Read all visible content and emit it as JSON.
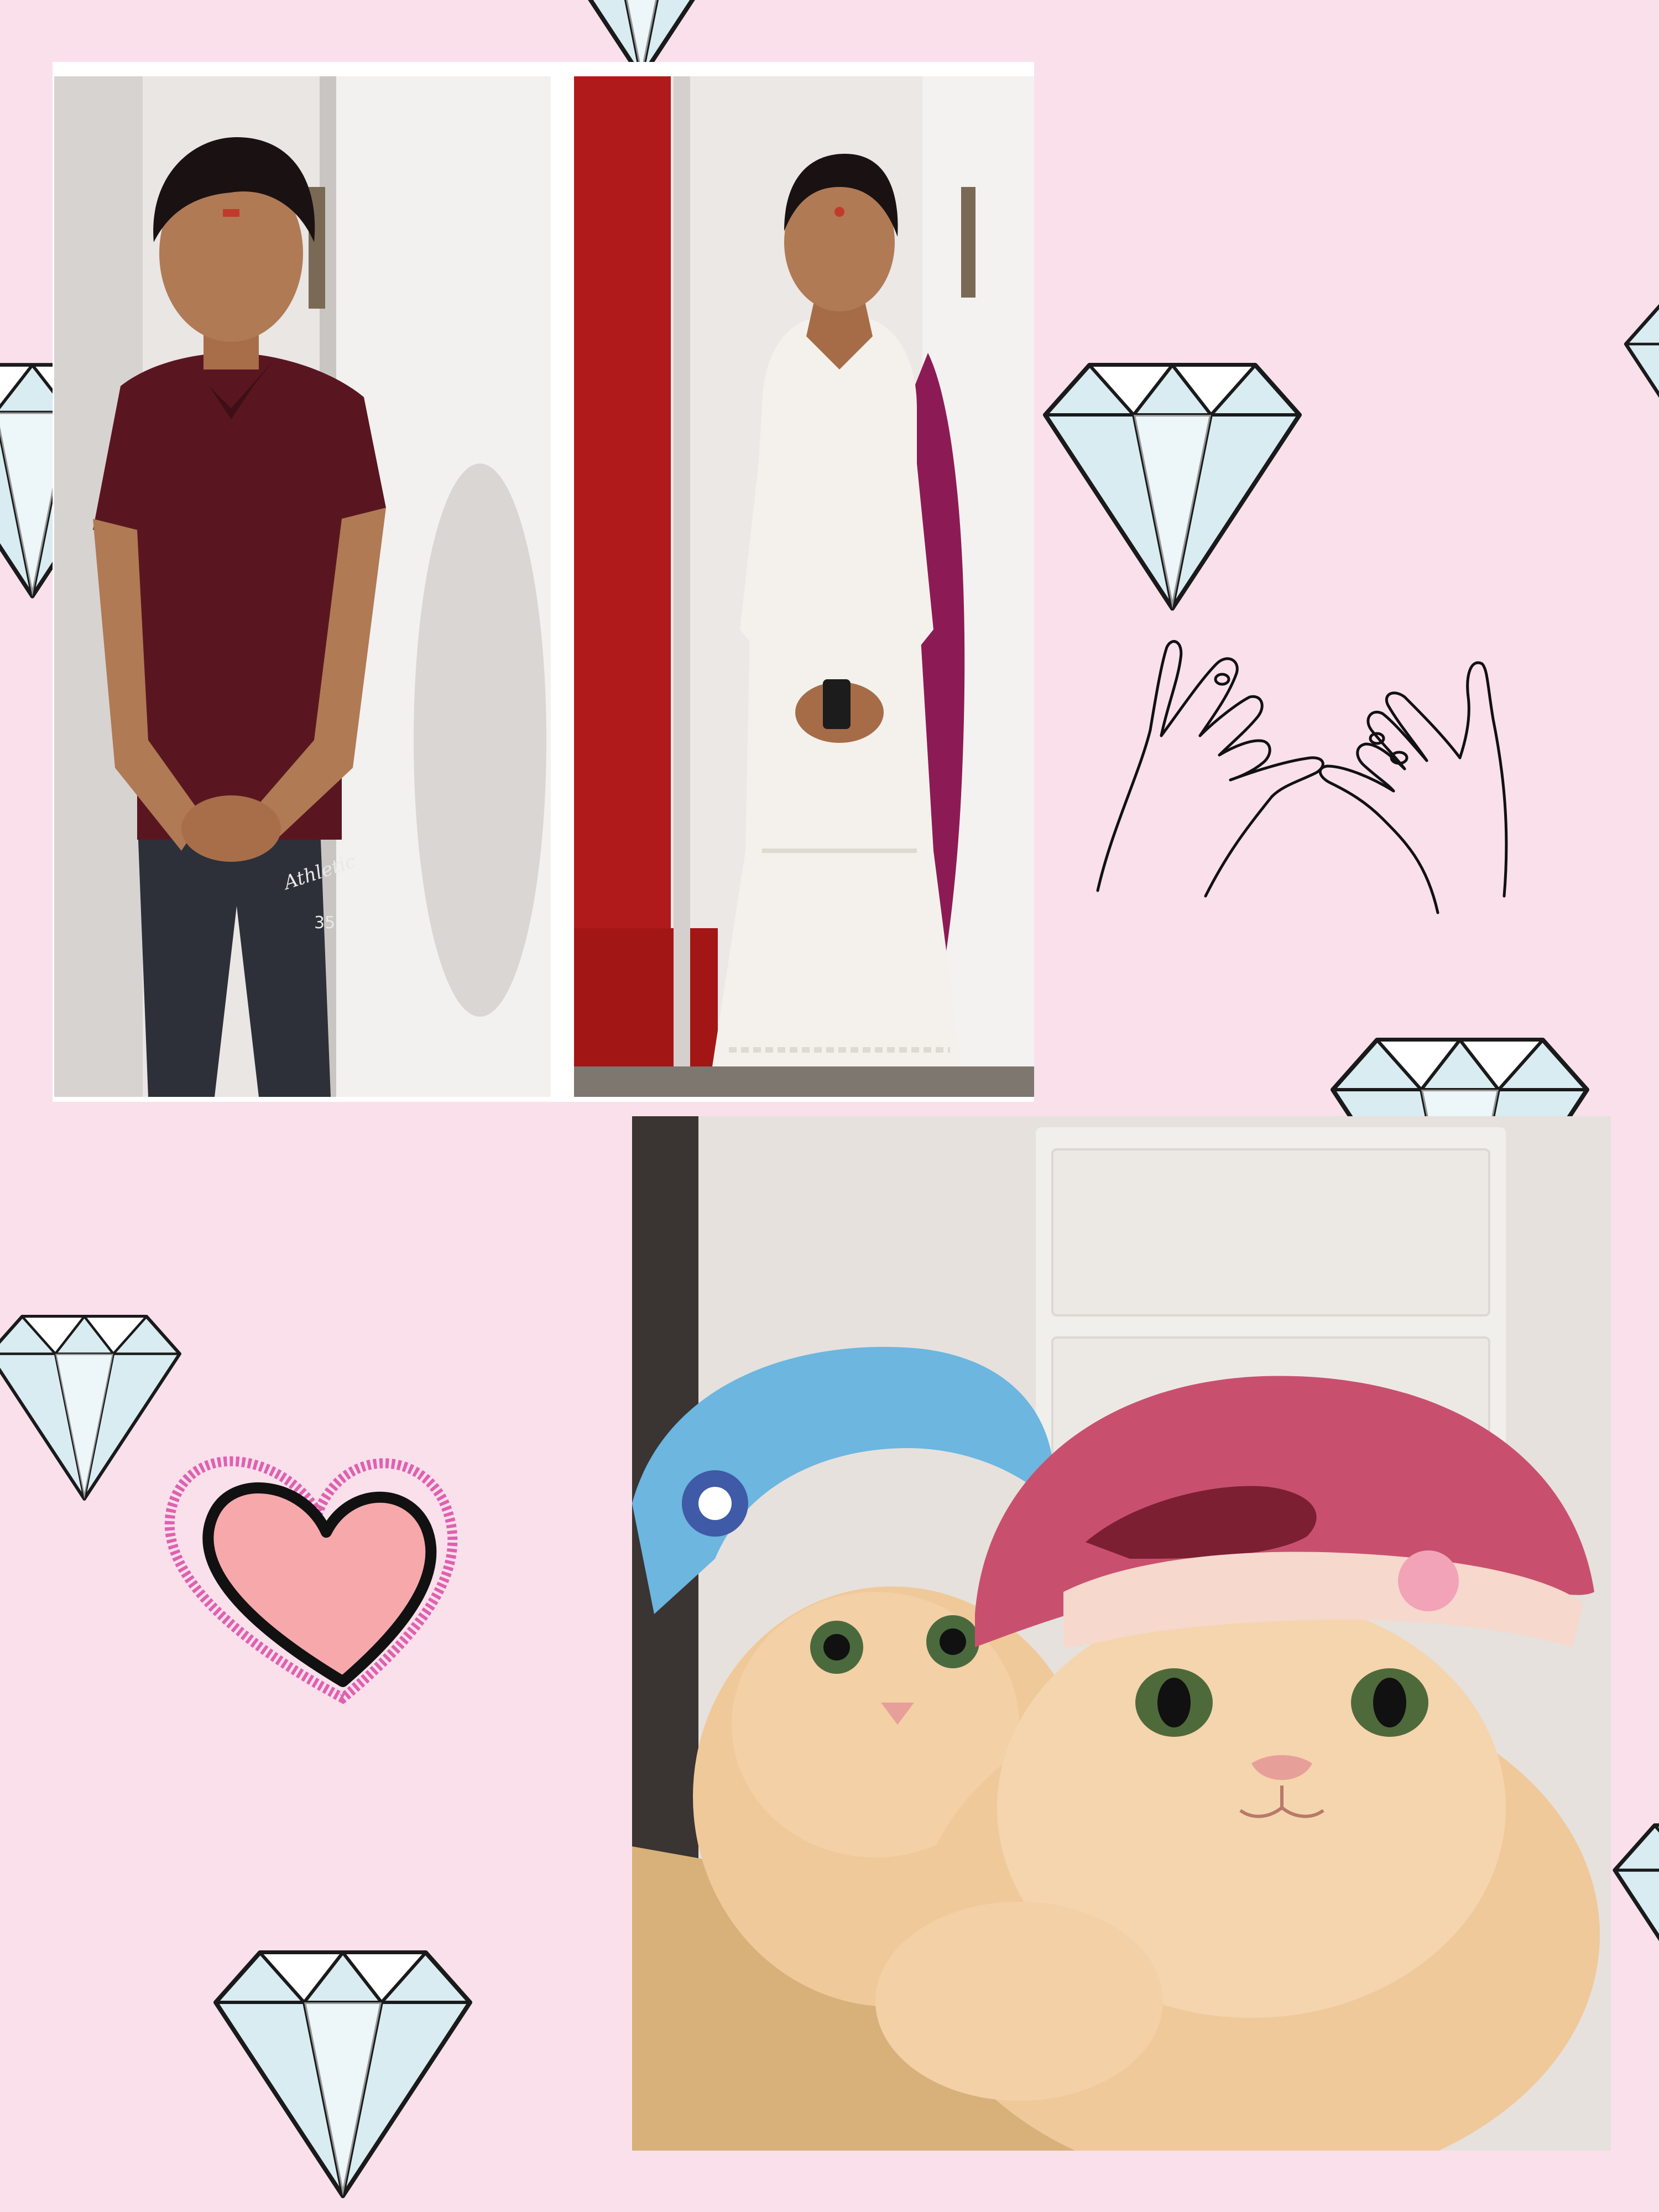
{
  "canvas": {
    "background": "#f9e0ea"
  },
  "colors": {
    "diamond_fill": "#d8ecf2",
    "diamond_stroke": "#1a1a1a",
    "heart_fill": "#f6a8aa",
    "heart_glitter": "#e060b0",
    "frame": "#ffffff",
    "shirt": "#5a1620",
    "trousers": "#2d3038",
    "dress": "#f4f1ec",
    "dupatta": "#8c1b55",
    "wall": "#e9e6e4",
    "door_red": "#b11a1a",
    "cat_fur": "#f0c99a",
    "hat_blue": "#6cb6e0",
    "hat_pink": "#c8506e",
    "wood": "#d8b07a"
  },
  "decorations": {
    "diamonds": [
      "diamond-icon",
      "diamond-icon",
      "diamond-icon",
      "diamond-icon",
      "diamond-icon",
      "diamond-icon",
      "diamond-icon",
      "diamond-icon",
      "diamond-icon"
    ],
    "heart": "heart-icon",
    "pinky_promise": "pinky-promise-hands-icon"
  },
  "photos": {
    "man": "photo-man-in-maroon-polo",
    "woman": "photo-woman-in-white-kurta",
    "cats": "photo-two-cats-in-hats"
  },
  "text": {
    "shorts_logo_line1": "Athletic",
    "shorts_logo_line2": "35"
  }
}
